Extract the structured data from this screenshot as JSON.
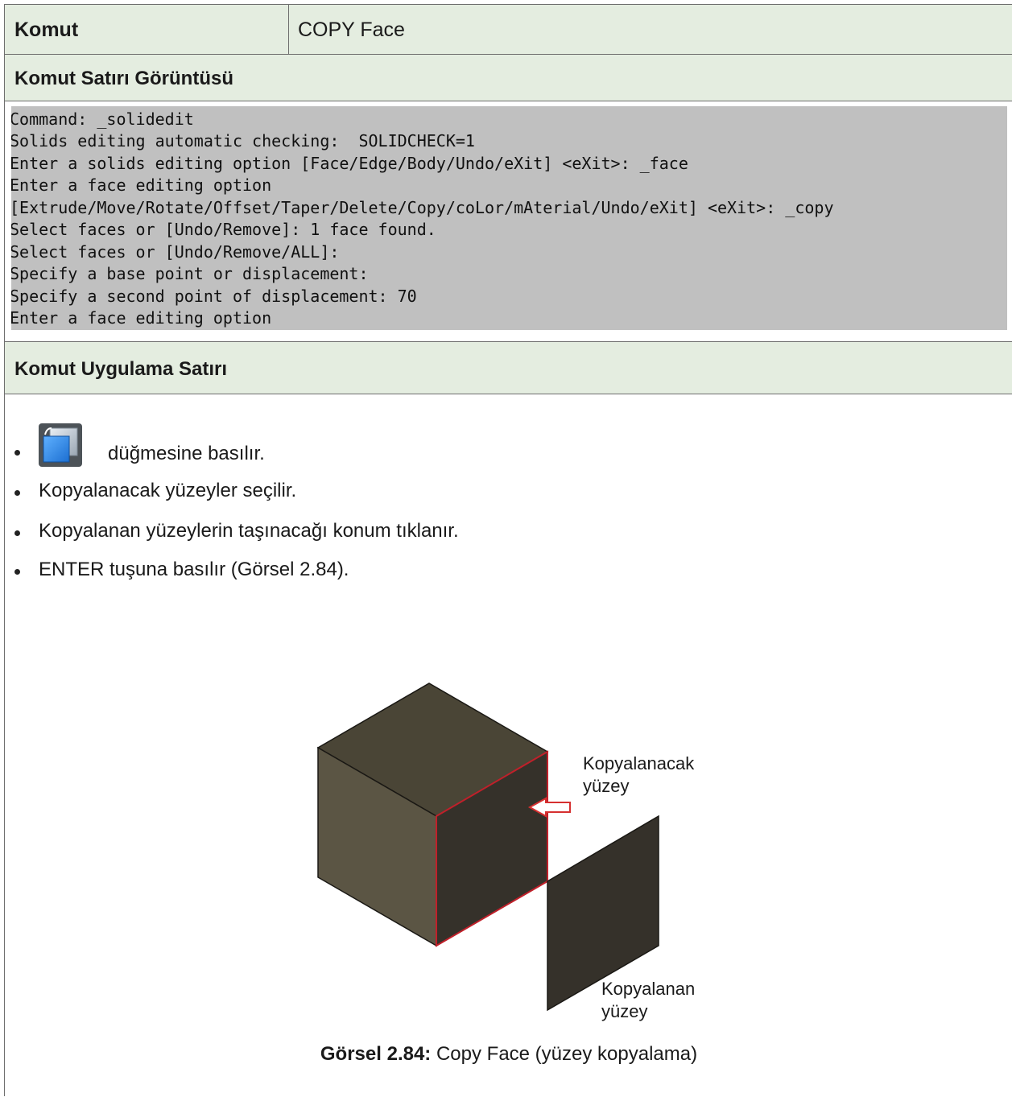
{
  "command_row": {
    "label": "Komut",
    "value": "COPY Face"
  },
  "command_line_section": {
    "heading": "Komut Satırı Görüntüsü",
    "lines": [
      "Command: _solidedit",
      "Solids editing automatic checking:  SOLIDCHECK=1",
      "Enter a solids editing option [Face/Edge/Body/Undo/eXit] <eXit>: _face",
      "Enter a face editing option",
      "[Extrude/Move/Rotate/Offset/Taper/Delete/Copy/coLor/mAterial/Undo/eXit] <eXit>: _copy",
      "Select faces or [Undo/Remove]: 1 face found.",
      "Select faces or [Undo/Remove/ALL]:",
      "Specify a base point or displacement:",
      "Specify a second point of displacement: 70",
      "Enter a face editing option"
    ]
  },
  "application_section": {
    "heading": "Komut Uygulama Satırı",
    "icon": "copy-faces-tool-icon",
    "bullets": [
      "düğmesine basılır.",
      "Kopyalanacak yüzeyler seçilir.",
      "Kopyalanan yüzeylerin taşınacağı konum tıklanır.",
      "ENTER tuşuna basılır (Görsel 2.84)."
    ]
  },
  "figure": {
    "label_source_line1": "Kopyalanacak",
    "label_source_line2": "yüzey",
    "label_copy_line1": "Kopyalanan",
    "label_copy_line2": "yüzey",
    "caption_bold": "Görsel 2.84:",
    "caption_text": " Copy Face (yüzey kopyalama)",
    "colors": {
      "top": "#4a4536",
      "left": "#5b5544",
      "right": "#35312a",
      "edge": "#c0202a",
      "arrow": "#d63030"
    }
  }
}
